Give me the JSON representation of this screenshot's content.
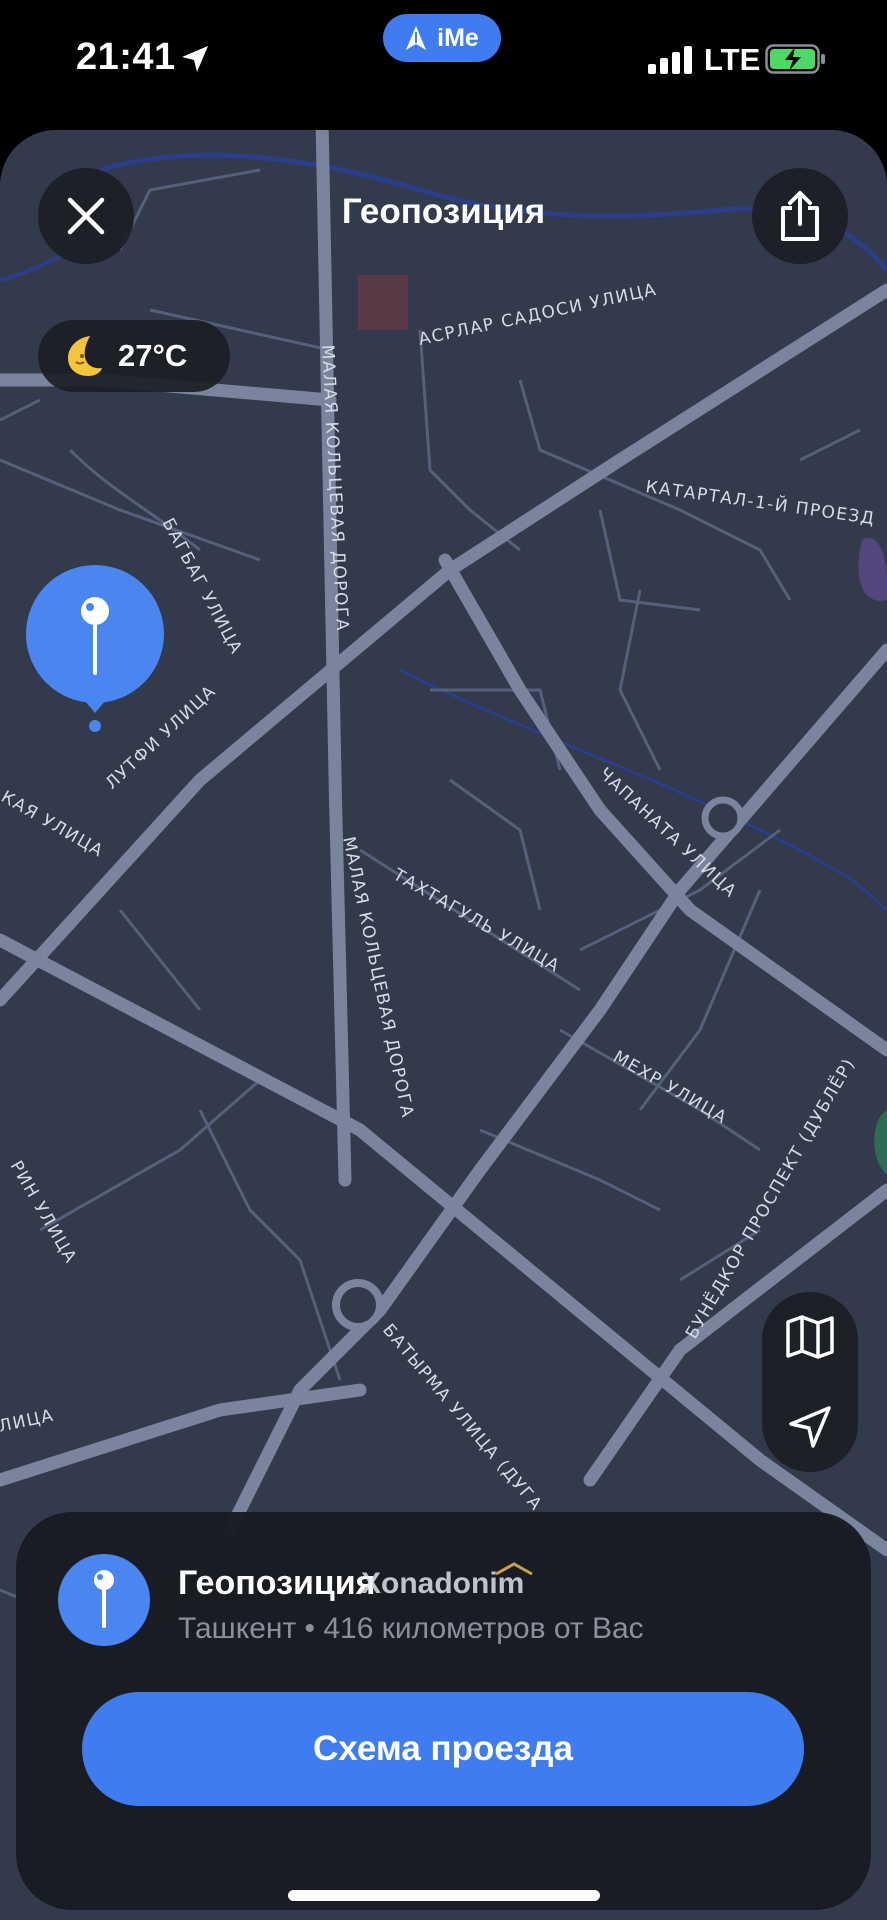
{
  "status_bar": {
    "time": "21:41",
    "app_pill": "iMe",
    "network": "LTE",
    "icons": [
      "location-arrow-icon",
      "signal-bars-icon",
      "battery-charging-icon"
    ]
  },
  "header": {
    "title": "Геопозиция",
    "close_icon": "close-icon",
    "share_icon": "share-icon"
  },
  "weather": {
    "icon": "moon-icon",
    "temperature": "27°C"
  },
  "map": {
    "streets": [
      "АСРЛАР САДОСИ УЛИЦА",
      "КАТАРТАЛ-1-Й ПРОЕЗД",
      "МАЛАЯ КОЛЬЦЕВАЯ ДОРОГА",
      "БАГБАГ УЛИЦА",
      "ЛУТФИ УЛИЦА",
      "КАЯ УЛИЦА",
      "ЧАПАНАТА УЛИЦА",
      "ТАХТАГУЛЬ УЛИЦА",
      "МАЛАЯ КОЛЬЦЕВАЯ ДОРОГА",
      "МЕХР УЛИЦА",
      "БУНЁДКОР ПРОСПЕКТ (ДУБЛЁР)",
      "РИН УЛИЦА",
      "ЛИЦА",
      "БАТЫРМА УЛИЦА (ДУГА"
    ],
    "controls": [
      "map-icon",
      "location-arrow-icon"
    ],
    "accent": "#4a86f0"
  },
  "place": {
    "name": "Геопозиция",
    "subtitle": "Ташкент • 416 километров от Вас",
    "watermark": "Xonadonim"
  },
  "actions": {
    "route_label": "Схема проезда"
  }
}
